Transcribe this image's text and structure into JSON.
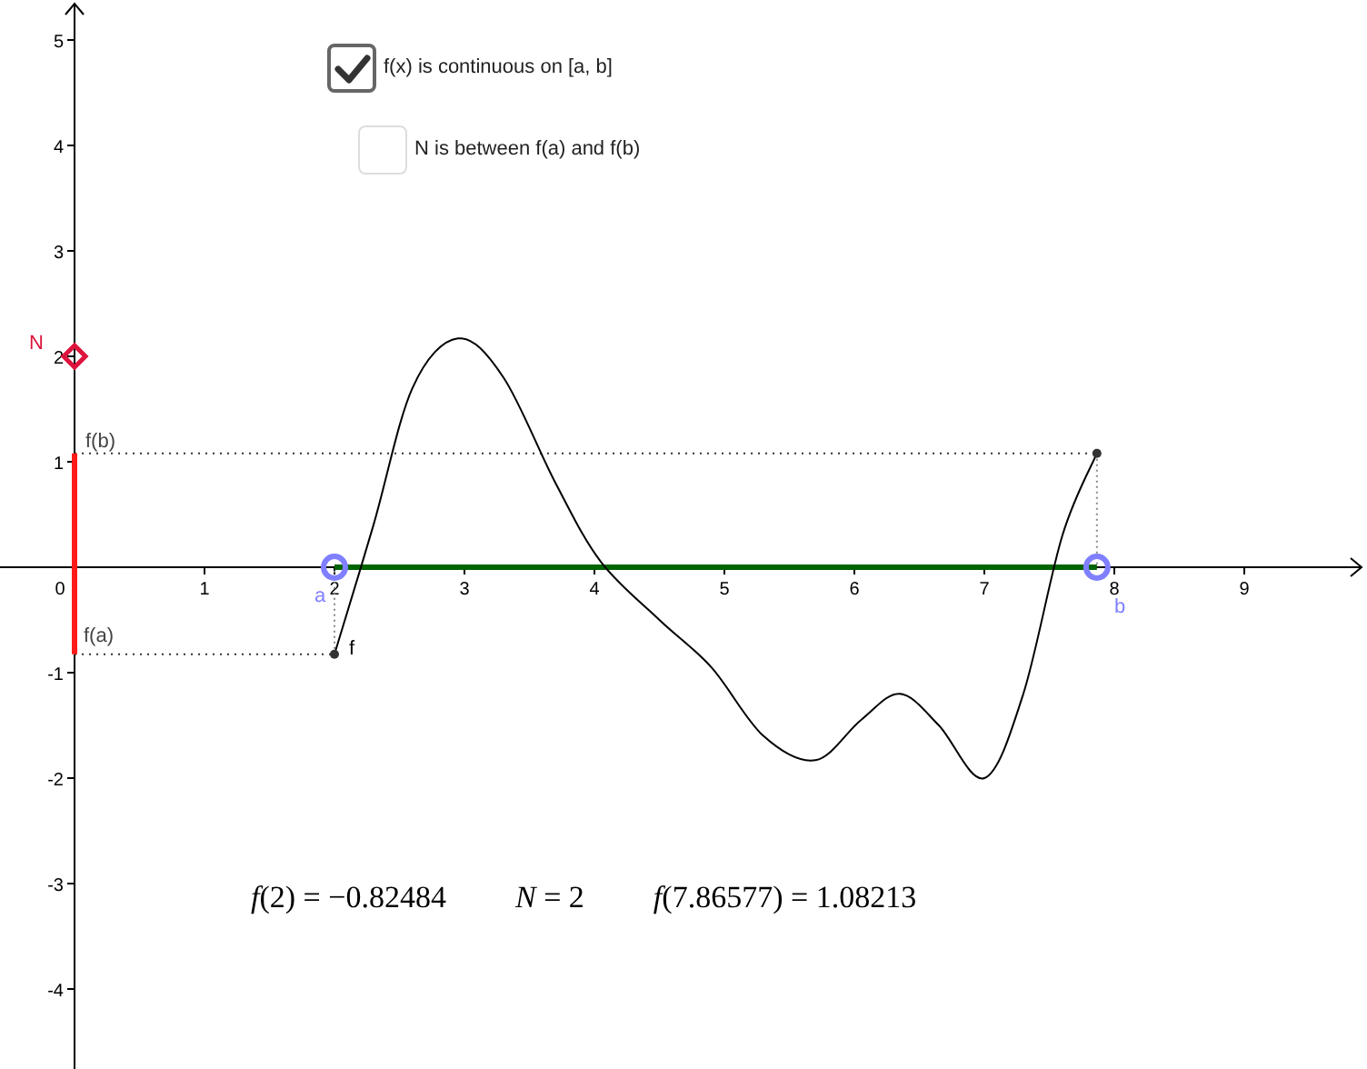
{
  "checkboxes": [
    {
      "label": "f(x) is continuous on [a, b]",
      "checked": true
    },
    {
      "label": "N is between f(a) and f(b)",
      "checked": false
    }
  ],
  "graph": {
    "x_ticks": [
      "0",
      "1",
      "2",
      "3",
      "4",
      "5",
      "6",
      "7",
      "8",
      "9"
    ],
    "y_ticks": [
      "5",
      "4",
      "3",
      "2",
      "1",
      "-1",
      "-2",
      "-3",
      "-4"
    ],
    "labels": {
      "point_n": "N",
      "level_fb": "f(b)",
      "level_fa": "f(a)",
      "point_a": "a",
      "point_b": "b",
      "function": "f"
    }
  },
  "values": [
    "*f*(2) = −0.82484",
    "*N* = 2",
    "*f*(7.86577) = 1.08213"
  ]
}
